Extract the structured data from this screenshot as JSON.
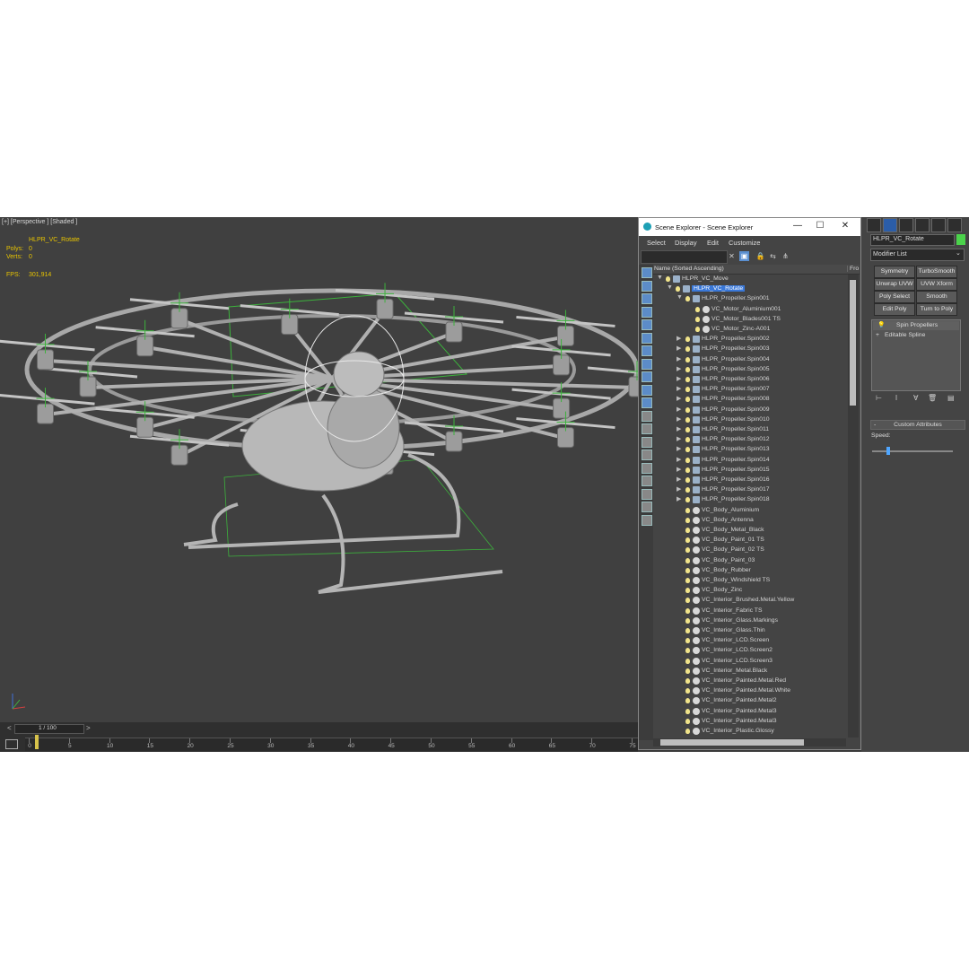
{
  "viewport": {
    "label": "[+] [Perspective ] [Shaded ]",
    "selected_name": "HLPR_VC_Rotate",
    "polys_label": "Polys:",
    "polys_value": "0",
    "verts_label": "Verts:",
    "verts_value": "0",
    "fps_label": "FPS:",
    "fps_value": "301,914"
  },
  "timeline": {
    "frame": "1 / 100",
    "prev": "<",
    "next": ">",
    "ticks": [
      "0",
      "5",
      "10",
      "15",
      "20",
      "25",
      "30",
      "35",
      "40",
      "45",
      "50",
      "55",
      "60",
      "65",
      "70",
      "75"
    ]
  },
  "explorer": {
    "title": "Scene Explorer - Scene Explorer",
    "minimize": "—",
    "maximize": "☐",
    "close": "✕",
    "menu": [
      "Select",
      "Display",
      "Edit",
      "Customize"
    ],
    "column_name": "Name (Sorted Ascending)",
    "column_frozen": "Fro",
    "rows": [
      {
        "name": "HLPR_VC_Move",
        "depth": 0,
        "expanded": true,
        "kind": "helper"
      },
      {
        "name": "HLPR_VC_Rotate",
        "depth": 1,
        "expanded": true,
        "kind": "helper",
        "selected": true
      },
      {
        "name": "HLPR_Propeller.Spin001",
        "depth": 2,
        "expanded": true,
        "kind": "helper"
      },
      {
        "name": "VC_Motor_Aluminium001",
        "depth": 3,
        "kind": "object"
      },
      {
        "name": "VC_Motor_Blades001 TS",
        "depth": 3,
        "kind": "object"
      },
      {
        "name": "VC_Motor_Zinc-A001",
        "depth": 3,
        "kind": "object"
      },
      {
        "name": "HLPR_Propeller.Spin002",
        "depth": 2,
        "expanded": false,
        "kind": "helper"
      },
      {
        "name": "HLPR_Propeller.Spin003",
        "depth": 2,
        "expanded": false,
        "kind": "helper"
      },
      {
        "name": "HLPR_Propeller.Spin004",
        "depth": 2,
        "expanded": false,
        "kind": "helper"
      },
      {
        "name": "HLPR_Propeller.Spin005",
        "depth": 2,
        "expanded": false,
        "kind": "helper"
      },
      {
        "name": "HLPR_Propeller.Spin006",
        "depth": 2,
        "expanded": false,
        "kind": "helper"
      },
      {
        "name": "HLPR_Propeller.Spin007",
        "depth": 2,
        "expanded": false,
        "kind": "helper"
      },
      {
        "name": "HLPR_Propeller.Spin008",
        "depth": 2,
        "expanded": false,
        "kind": "helper"
      },
      {
        "name": "HLPR_Propeller.Spin009",
        "depth": 2,
        "expanded": false,
        "kind": "helper"
      },
      {
        "name": "HLPR_Propeller.Spin010",
        "depth": 2,
        "expanded": false,
        "kind": "helper"
      },
      {
        "name": "HLPR_Propeller.Spin011",
        "depth": 2,
        "expanded": false,
        "kind": "helper"
      },
      {
        "name": "HLPR_Propeller.Spin012",
        "depth": 2,
        "expanded": false,
        "kind": "helper"
      },
      {
        "name": "HLPR_Propeller.Spin013",
        "depth": 2,
        "expanded": false,
        "kind": "helper"
      },
      {
        "name": "HLPR_Propeller.Spin014",
        "depth": 2,
        "expanded": false,
        "kind": "helper"
      },
      {
        "name": "HLPR_Propeller.Spin015",
        "depth": 2,
        "expanded": false,
        "kind": "helper"
      },
      {
        "name": "HLPR_Propeller.Spin016",
        "depth": 2,
        "expanded": false,
        "kind": "helper"
      },
      {
        "name": "HLPR_Propeller.Spin017",
        "depth": 2,
        "expanded": false,
        "kind": "helper"
      },
      {
        "name": "HLPR_Propeller.Spin018",
        "depth": 2,
        "expanded": false,
        "kind": "helper"
      },
      {
        "name": "VC_Body_Aluminium",
        "depth": 2,
        "kind": "object"
      },
      {
        "name": "VC_Body_Antenna",
        "depth": 2,
        "kind": "object"
      },
      {
        "name": "VC_Body_Metal_Black",
        "depth": 2,
        "kind": "object"
      },
      {
        "name": "VC_Body_Paint_01 TS",
        "depth": 2,
        "kind": "object"
      },
      {
        "name": "VC_Body_Paint_02 TS",
        "depth": 2,
        "kind": "object"
      },
      {
        "name": "VC_Body_Paint_03",
        "depth": 2,
        "kind": "object"
      },
      {
        "name": "VC_Body_Rubber",
        "depth": 2,
        "kind": "object"
      },
      {
        "name": "VC_Body_Windshield TS",
        "depth": 2,
        "kind": "object"
      },
      {
        "name": "VC_Body_Zinc",
        "depth": 2,
        "kind": "object"
      },
      {
        "name": "VC_Interior_Brushed.Metal.Yellow",
        "depth": 2,
        "kind": "object"
      },
      {
        "name": "VC_Interior_Fabric TS",
        "depth": 2,
        "kind": "object"
      },
      {
        "name": "VC_Interior_Glass.Markings",
        "depth": 2,
        "kind": "object"
      },
      {
        "name": "VC_Interior_Glass.Thin",
        "depth": 2,
        "kind": "object"
      },
      {
        "name": "VC_Interior_LCD.Screen",
        "depth": 2,
        "kind": "object"
      },
      {
        "name": "VC_Interior_LCD.Screen2",
        "depth": 2,
        "kind": "object"
      },
      {
        "name": "VC_Interior_LCD.Screen3",
        "depth": 2,
        "kind": "object"
      },
      {
        "name": "VC_Interior_Metal.Black",
        "depth": 2,
        "kind": "object"
      },
      {
        "name": "VC_Interior_Painted.Metal.Red",
        "depth": 2,
        "kind": "object"
      },
      {
        "name": "VC_Interior_Painted.Metal.White",
        "depth": 2,
        "kind": "object"
      },
      {
        "name": "VC_Interior_Painted.Metal2",
        "depth": 2,
        "kind": "object"
      },
      {
        "name": "VC_Interior_Painted.Metal3",
        "depth": 2,
        "kind": "object"
      },
      {
        "name": "VC_Interior_Painted.Metal3",
        "depth": 2,
        "kind": "object"
      },
      {
        "name": "VC_Interior_Plastic.Glossy",
        "depth": 2,
        "kind": "object"
      }
    ]
  },
  "command_panel": {
    "object_name": "HLPR_VC_Rotate",
    "object_color": "#4bd34b",
    "modifier_list": "Modifier List",
    "buttons": [
      "Symmetry",
      "TurboSmooth",
      "Unwrap UVW",
      "UVW Xform",
      "Poly Select",
      "Smooth",
      "Edit Poly",
      "Turn to Poly"
    ],
    "stack": [
      "Spin Propellers",
      "Editable Spline"
    ],
    "rollout_title": "Custom Attributes",
    "speed_label": "Speed:",
    "speed_value": 0.2
  }
}
